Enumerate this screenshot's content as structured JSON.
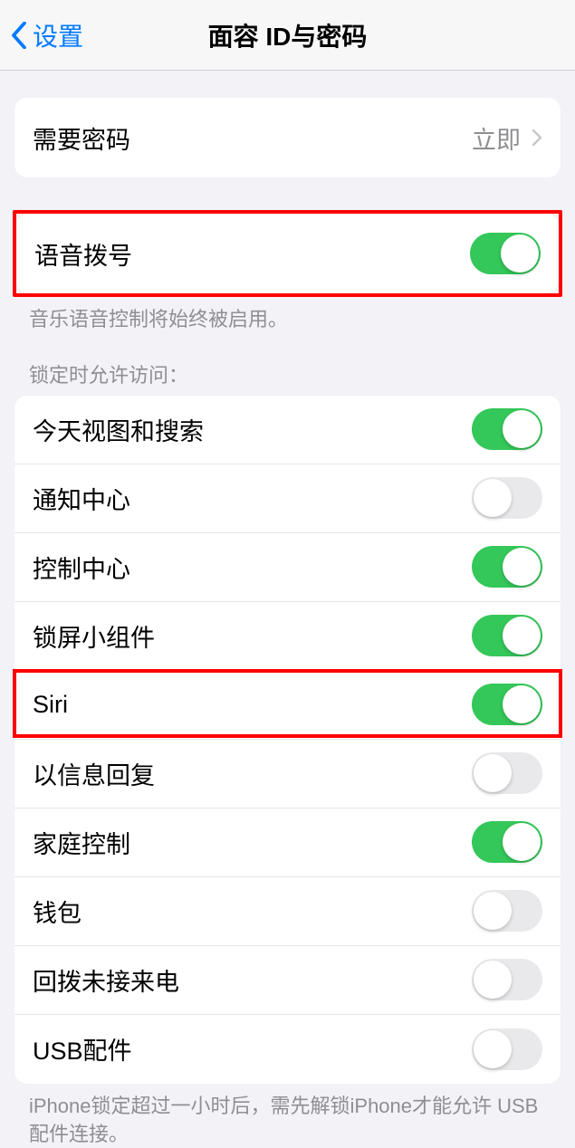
{
  "nav": {
    "back_label": "设置",
    "title": "面容 ID与密码"
  },
  "require_passcode": {
    "label": "需要密码",
    "value": "立即"
  },
  "voice_dial": {
    "label": "语音拨号",
    "enabled": true,
    "footer": "音乐语音控制将始终被启用。"
  },
  "lock_access": {
    "header": "锁定时允许访问：",
    "items": [
      {
        "label": "今天视图和搜索",
        "enabled": true
      },
      {
        "label": "通知中心",
        "enabled": false
      },
      {
        "label": "控制中心",
        "enabled": true
      },
      {
        "label": "锁屏小组件",
        "enabled": true
      },
      {
        "label": "Siri",
        "enabled": true
      },
      {
        "label": "以信息回复",
        "enabled": false
      },
      {
        "label": "家庭控制",
        "enabled": true
      },
      {
        "label": "钱包",
        "enabled": false
      },
      {
        "label": "回拨未接来电",
        "enabled": false
      },
      {
        "label": "USB配件",
        "enabled": false
      }
    ],
    "footer": "iPhone锁定超过一小时后，需先解锁iPhone才能允许 USB 配件连接。"
  },
  "highlighted_indexes": [
    4
  ]
}
